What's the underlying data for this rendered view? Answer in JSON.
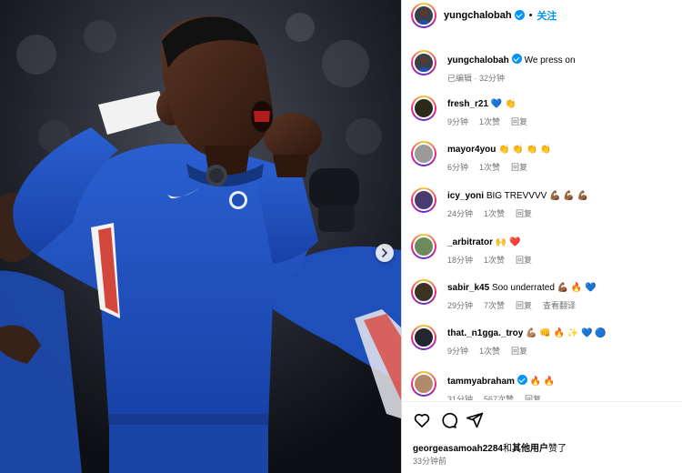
{
  "post": {
    "author": "yungchalobah",
    "follow_label": "关注",
    "dot": "•",
    "caption_text": "We press on",
    "caption_meta": "已编辑 · 32分钟"
  },
  "comments": [
    {
      "user": "fresh_r21",
      "text": "💙 👏",
      "time": "9分钟",
      "likes": "1次赞",
      "reply": "回复",
      "translate": "",
      "verified": false,
      "avatar_color": "#2b2b1c"
    },
    {
      "user": "mayor4you",
      "text": "👏 👏 👏 👏",
      "time": "6分钟",
      "likes": "1次赞",
      "reply": "回复",
      "translate": "",
      "verified": false,
      "avatar_color": "#9a9a9a"
    },
    {
      "user": "icy_yoni",
      "text": "BIG TREVVVV 💪🏾 💪🏾 💪🏾",
      "time": "24分钟",
      "likes": "1次赞",
      "reply": "回复",
      "translate": "",
      "verified": false,
      "avatar_color": "#4a3b6e"
    },
    {
      "user": "_arbitrator",
      "text": "🙌 ❤️",
      "time": "18分钟",
      "likes": "1次赞",
      "reply": "回复",
      "translate": "",
      "verified": false,
      "avatar_color": "#6d8a5a"
    },
    {
      "user": "sabir_k45",
      "text": "Soo underrated 💪🏾 🔥 💙",
      "time": "29分钟",
      "likes": "7次赞",
      "reply": "回复",
      "translate": "查看翻译",
      "verified": false,
      "avatar_color": "#3a3320"
    },
    {
      "user": "that._n1gga._troy",
      "text": "💪🏽 👊 🔥 ✨ 💙 🔵",
      "time": "9分钟",
      "likes": "1次赞",
      "reply": "回复",
      "translate": "",
      "verified": false,
      "avatar_color": "#222630"
    },
    {
      "user": "tammyabraham",
      "text": "🔥 🔥",
      "time": "31分钟",
      "likes": "567次赞",
      "reply": "回复",
      "translate": "",
      "verified": true,
      "avatar_color": "#b08a6a"
    }
  ],
  "actions": {
    "like_icon": "heart-icon",
    "comment_icon": "comment-icon",
    "share_icon": "share-icon",
    "liked_by_user": "georgeasamoah2284",
    "liked_by_joiner": "和",
    "liked_by_others": "其他用户",
    "liked_by_suffix": "赞了",
    "post_time": "33分钟前"
  },
  "colors": {
    "accent": "#0095f6",
    "chelsea_blue": "#1d4fb8",
    "secondary_text": "#737373"
  }
}
